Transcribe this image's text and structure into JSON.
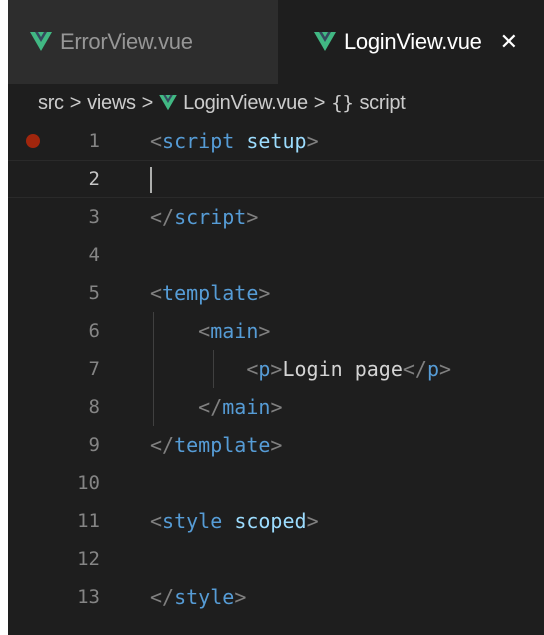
{
  "tabs": [
    {
      "label": "ErrorView.vue",
      "icon": "vue-icon",
      "active": false
    },
    {
      "label": "LoginView.vue",
      "icon": "vue-icon",
      "active": true,
      "close": "✕"
    }
  ],
  "breadcrumb": {
    "items": [
      "src",
      "views",
      "LoginView.vue",
      "script"
    ],
    "separator": ">",
    "symbol_glyph": "{}"
  },
  "editor": {
    "current_line": 2,
    "breakpoint_line": 1,
    "lines": [
      {
        "num": "1"
      },
      {
        "num": "2"
      },
      {
        "num": "3"
      },
      {
        "num": "4"
      },
      {
        "num": "5"
      },
      {
        "num": "6"
      },
      {
        "num": "7"
      },
      {
        "num": "8"
      },
      {
        "num": "9"
      },
      {
        "num": "10"
      },
      {
        "num": "11"
      },
      {
        "num": "12"
      },
      {
        "num": "13"
      }
    ],
    "code": {
      "l1_tag": "script",
      "l1_attr": "setup",
      "l3_tag": "script",
      "l5_tag": "template",
      "l6_tag": "main",
      "l7_tag": "p",
      "l7_text": "Login page",
      "l7_close_tag": "p",
      "l8_tag": "main",
      "l9_tag": "template",
      "l11_tag": "style",
      "l11_attr": "scoped",
      "l13_tag": "style"
    }
  },
  "colors": {
    "vue_green": "#41b883",
    "vue_dark": "#34495e",
    "tag": "#569cd6",
    "attribute": "#9cdcfe",
    "punctuation": "#808080",
    "breakpoint": "#a1260d",
    "editor_bg": "#1e1e1e"
  }
}
